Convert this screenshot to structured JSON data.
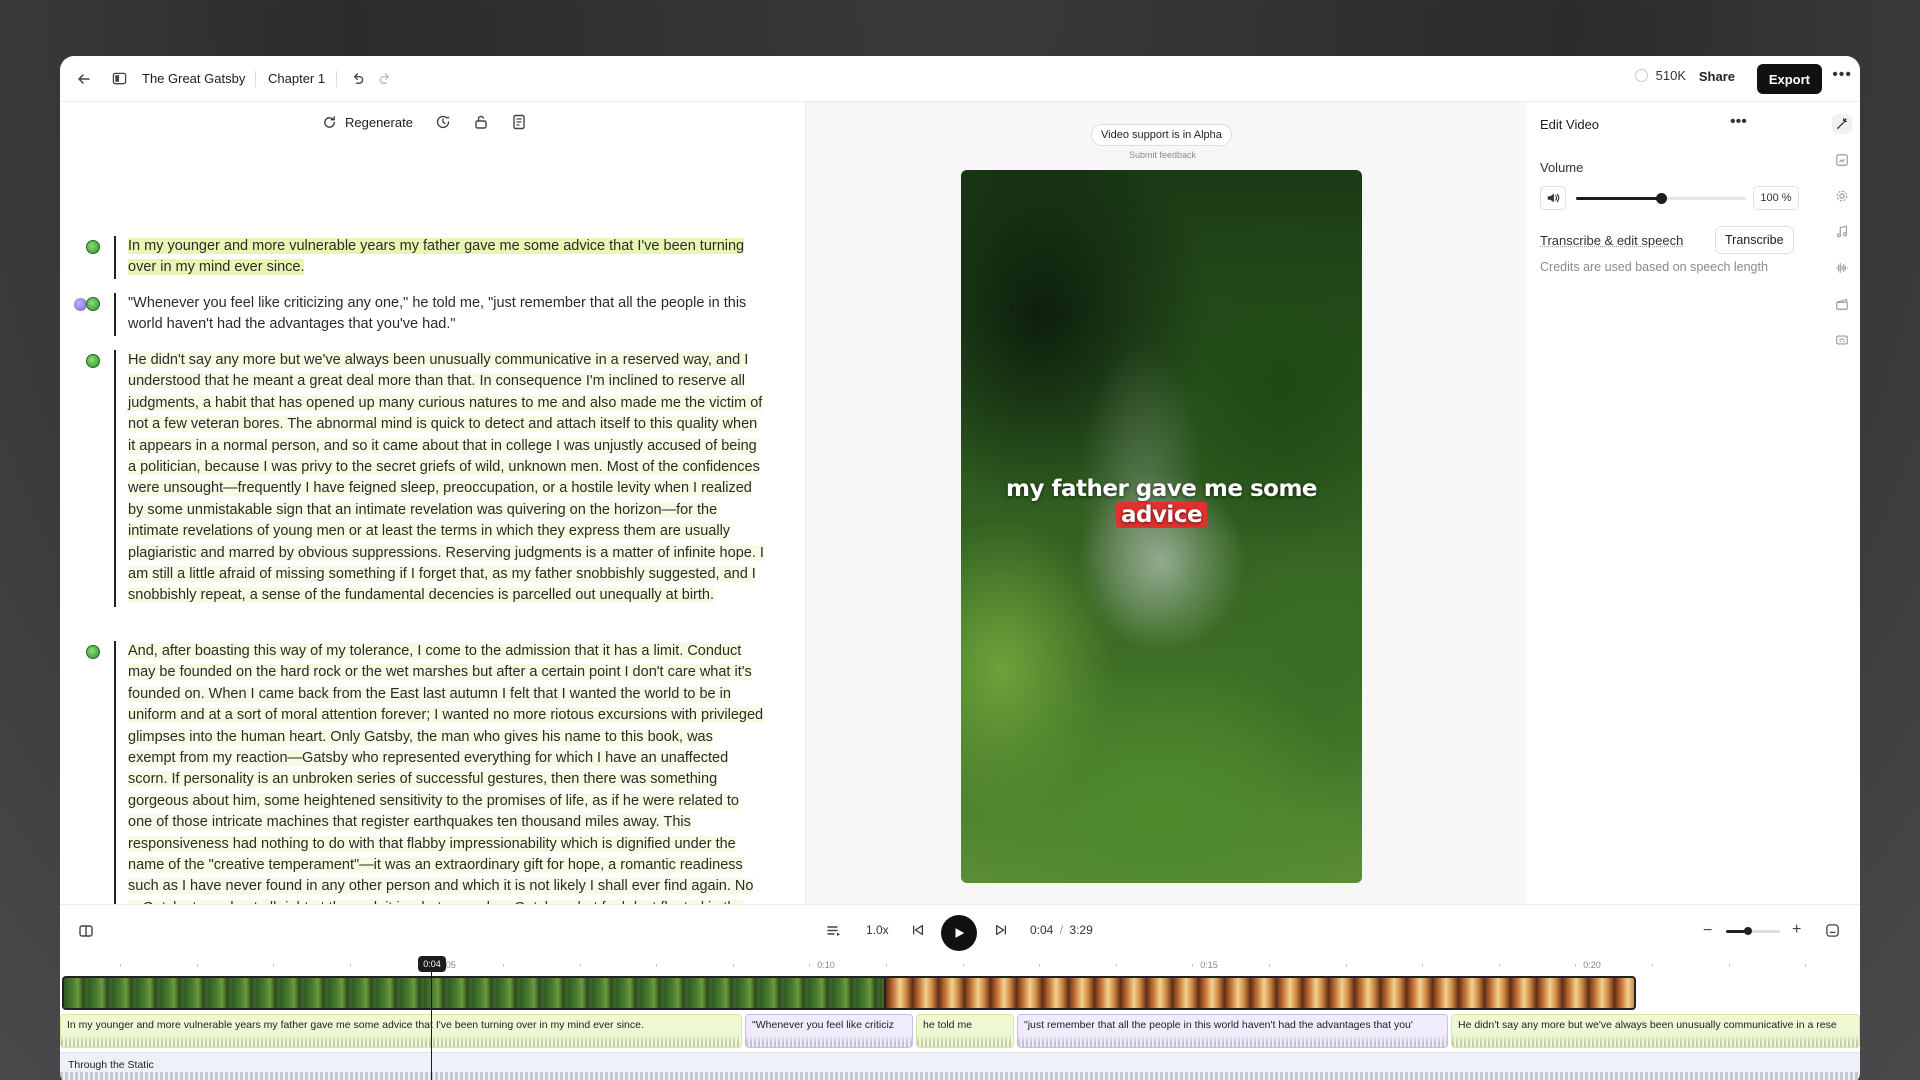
{
  "header": {
    "project": "The Great Gatsby",
    "chapter": "Chapter 1",
    "credits": "510K",
    "share": "Share",
    "export": "Export"
  },
  "toolbar": {
    "regenerate": "Regenerate"
  },
  "script": {
    "paragraphs": [
      "In my younger and more vulnerable years my father gave me some advice that I've been turning over in my mind ever since.",
      "\"Whenever you feel like criticizing any one,\" he told me, \"just remember that all the people in this world haven't had the advantages that you've had.\"",
      "He didn't say any more but we've always been unusually communicative in a reserved way, and I understood that he meant a great deal more than that. In consequence I'm inclined to reserve all judgments, a habit that has opened up many curious natures to me and also made me the victim of not a few veteran bores. The abnormal mind is quick to detect and attach itself to this quality when it appears in a normal person, and so it came about that in college I was unjustly accused of being a politician, because I was privy to the secret griefs of wild, unknown men. Most of the confidences were unsought—frequently I have feigned sleep, preoccupation, or a hostile levity when I realized by some unmistakable sign that an intimate revelation was quivering on the horizon—for the intimate revelations of young men or at least the terms in which they express them are usually plagiaristic and marred by obvious suppressions. Reserving judgments is a matter of infinite hope. I am still a little afraid of missing something if I forget that, as my father snobbishly suggested, and I snobbishly repeat, a sense of the fundamental decencies is parcelled out unequally at birth.",
      "And, after boasting this way of my tolerance, I come to the admission that it has a limit. Conduct may be founded on the hard rock or the wet marshes but after a certain point I don't care what it's founded on. When I came back from the East last autumn I felt that I wanted the world to be in uniform and at a sort of moral attention forever; I wanted no more riotous excursions with privileged glimpses into the human heart. Only Gatsby, the man who gives his name to this book, was exempt from my reaction—Gatsby who represented everything for which I have an unaffected scorn. If personality is an unbroken series of successful gestures, then there was something gorgeous about him, some heightened sensitivity to the promises of life, as if he were related to one of those intricate machines that register earthquakes ten thousand miles away. This responsiveness had nothing to do with that flabby impressionability which is dignified under the name of the \"creative temperament\"—it was an extraordinary gift for hope, a romantic readiness such as I have never found in any other person and which it is not likely I shall ever find again. No—Gatsby turned out all right at the end; it is what preyed on Gatsby, what foul dust floated in the wake of his dreams that temporarily closed out my interest in the abortive sorrows and short-winded elations of men."
    ]
  },
  "preview": {
    "alpha_badge": "Video support is in Alpha",
    "feedback": "Submit feedback",
    "caption_prefix": "my father gave me some",
    "caption_highlight": "advice",
    "highlight_color": "#e0312f"
  },
  "panel": {
    "title": "Edit Video",
    "volume_label": "Volume",
    "volume_value": "100 %",
    "volume_level": 0.5,
    "transcribe_label": "Transcribe & edit speech",
    "transcribe_button": "Transcribe",
    "credits_note": "Credits are used based on speech length"
  },
  "transport": {
    "speed": "1.0x",
    "time_current": "0:04",
    "time_separator": "/",
    "time_total": "3:29",
    "zoom_level": 0.4
  },
  "timeline": {
    "playhead": "0:04",
    "ruler_labels": [
      "0:05",
      "0:10",
      "0:15",
      "0:20"
    ],
    "clips": [
      {
        "text": "In my younger and more vulnerable years my father gave me some advice that I've been turning over in my mind ever since.",
        "style": "green"
      },
      {
        "text": "\"Whenever you feel like criticiz",
        "style": "purple"
      },
      {
        "text": "he told me",
        "style": "green"
      },
      {
        "text": "\"just remember that all the people in this world haven't had the advantages that you'",
        "style": "purple"
      },
      {
        "text": "He didn't say any more but we've always been unusually communicative in a rese",
        "style": "green"
      }
    ],
    "music_track": "Through the Static"
  }
}
